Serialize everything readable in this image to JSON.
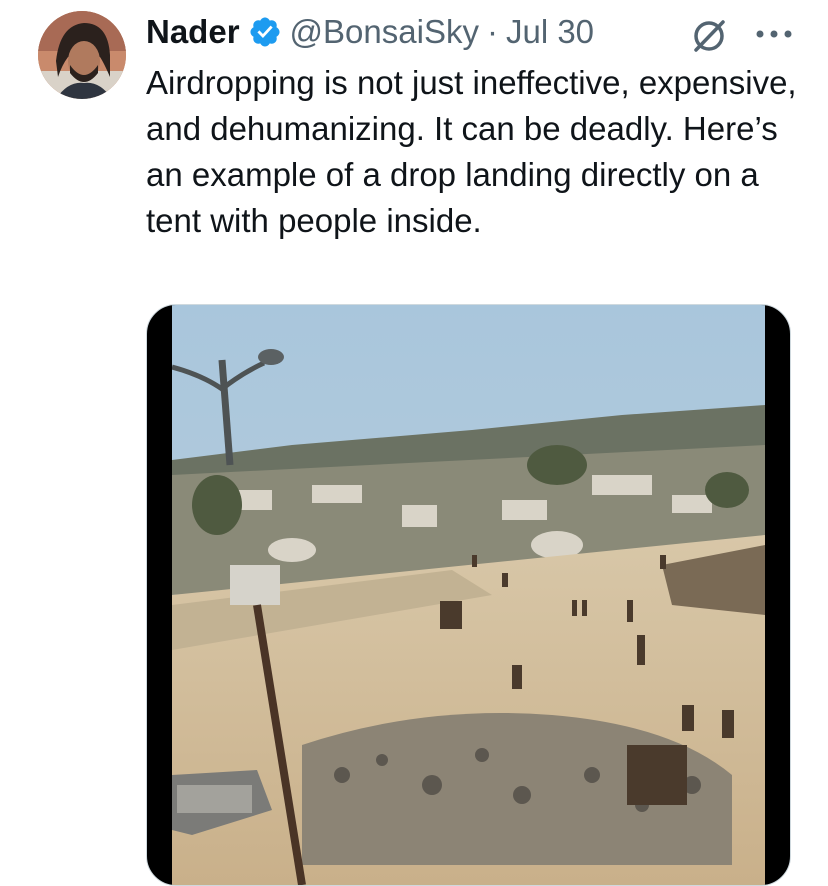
{
  "tweet": {
    "author_name": "Nader",
    "handle": "@BonsaiSky",
    "separator": "·",
    "date": "Jul 30",
    "text": "Airdropping is not just ineffective, expensive, and dehumanizing. It can be deadly. Here’s an example of a drop landing directly on a tent with people inside."
  },
  "icons": {
    "verified": "verified-badge-icon",
    "grok": "grok-icon",
    "more": "more-icon"
  },
  "colors": {
    "text": "#0f1419",
    "secondary_text": "#536471",
    "verified_blue": "#1d9bf0"
  }
}
